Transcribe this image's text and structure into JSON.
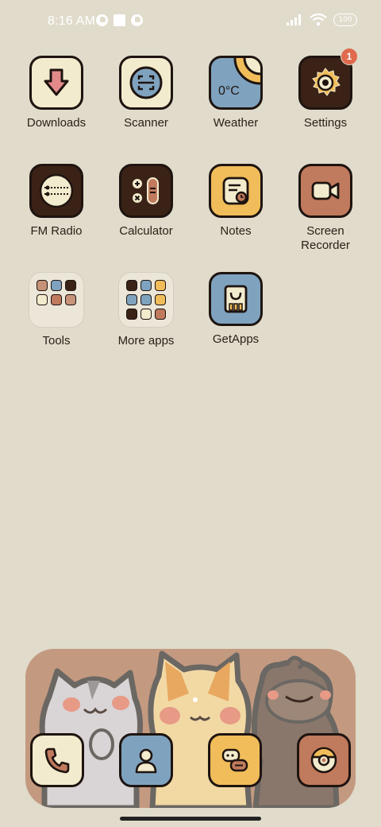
{
  "status_bar": {
    "time": "8:16 AM",
    "battery": "100",
    "left_icons": [
      "notification-app-icon",
      "notification-square-icon",
      "notification-app-icon"
    ],
    "right_icons": [
      "signal-icon",
      "wifi-icon",
      "battery-icon"
    ]
  },
  "apps": [
    {
      "label": "Downloads",
      "icon": "download-icon",
      "bg": "#f3ebcd"
    },
    {
      "label": "Scanner",
      "icon": "scanner-icon",
      "bg": "#f3ebcd"
    },
    {
      "label": "Weather",
      "icon": "weather-icon",
      "bg": "#7fa3bf",
      "icon_text": "0°C"
    },
    {
      "label": "Settings",
      "icon": "gear-icon",
      "bg": "#3b2216",
      "badge": "1"
    },
    {
      "label": "FM Radio",
      "icon": "radio-icon",
      "bg": "#3b2216"
    },
    {
      "label": "Calculator",
      "icon": "calculator-icon",
      "bg": "#3b2216"
    },
    {
      "label": "Notes",
      "icon": "notes-icon",
      "bg": "#f1bd5a"
    },
    {
      "label": "Screen\nRecorder",
      "icon": "video-camera-icon",
      "bg": "#c07a5d"
    },
    {
      "label": "Tools",
      "icon": "folder-icon"
    },
    {
      "label": "More apps",
      "icon": "folder-icon"
    },
    {
      "label": "GetApps",
      "icon": "getapps-icon",
      "bg": "#7fa3bf"
    }
  ],
  "folders": {
    "tools": {
      "minis": [
        "#c69378",
        "#7fa3bf",
        "#3b2216",
        "#f3ebcd",
        "#c07a5d",
        "#c69378",
        "#f3ebcd",
        "#7fa3bf",
        "#f1bd5a"
      ]
    },
    "more_apps": {
      "minis": [
        "#3b2216",
        "#7fa3bf",
        "#f1bd5a",
        "#7fa3bf",
        "#7fa3bf",
        "#f1bd5a",
        "#3b2216",
        "#f3ebcd",
        "#c07a5d"
      ]
    }
  },
  "dock": {
    "apps": [
      {
        "icon": "phone-icon",
        "bg": "#f3ebcd"
      },
      {
        "icon": "contacts-icon",
        "bg": "#7fa3bf"
      },
      {
        "icon": "messages-icon",
        "bg": "#f1bd5a"
      },
      {
        "icon": "camera-icon",
        "bg": "#c07a5d"
      }
    ]
  }
}
